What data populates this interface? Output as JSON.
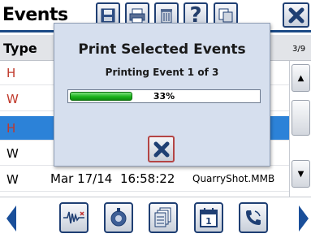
{
  "title": "Events",
  "toolbar": {
    "save_icon": "save-icon",
    "print_icon": "printer-icon",
    "delete_icon": "trash-icon",
    "help_label": "?",
    "copy_icon": "copy-icon",
    "close_icon": "close-icon"
  },
  "list": {
    "column_type": "Type",
    "page_indicator": "3/9",
    "rows": [
      {
        "type": "H",
        "type_color": "#c0392b",
        "date": "",
        "time": "",
        "file": "",
        "selected": false
      },
      {
        "type": "W",
        "type_color": "#c0392b",
        "date": "",
        "time": "",
        "file": "",
        "selected": false
      },
      {
        "type": "H",
        "type_color": "#c0392b",
        "date": "",
        "time": "",
        "file": "",
        "selected": true
      },
      {
        "type": "W",
        "type_color": "#000000",
        "date": "",
        "time": "",
        "file": "",
        "selected": false
      },
      {
        "type": "W",
        "type_color": "#000000",
        "date": "Mar 17/14",
        "time": "16:58:22",
        "file": "QuarryShot.MMB",
        "selected": false
      }
    ]
  },
  "modal": {
    "title": "Print Selected Events",
    "subtitle": "Printing Event 1 of 3",
    "progress_label": "33%",
    "progress_fraction": 0.33
  },
  "bottom_bar": {
    "buttons": [
      "waveform-icon",
      "sensor-icon",
      "pages-icon",
      "calendar-icon",
      "phone-icon"
    ]
  },
  "colors": {
    "accent_blue": "#1b4a86",
    "selected_row": "#2c82d8",
    "progress_green": "#1bb31b",
    "close_red": "#b44545"
  }
}
